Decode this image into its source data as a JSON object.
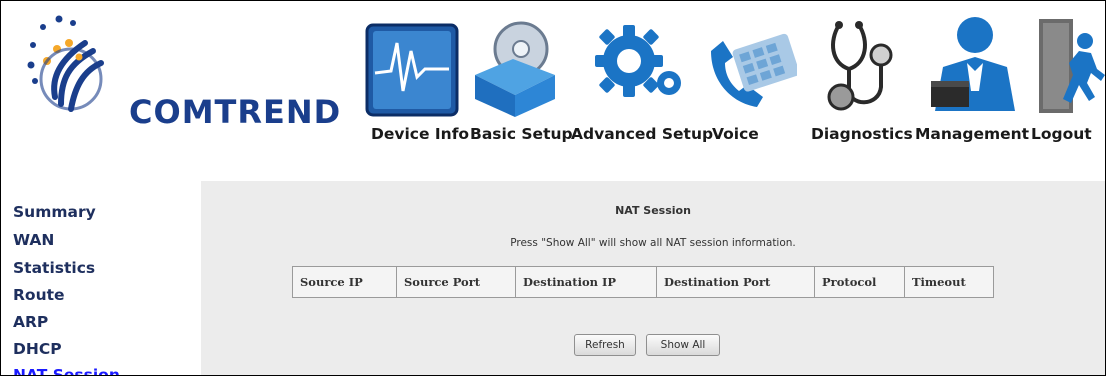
{
  "header": {
    "brand": "COMTREND",
    "nav": [
      {
        "label": "Device Info",
        "icon": "device-info-icon"
      },
      {
        "label": "Basic Setup",
        "icon": "basic-setup-icon"
      },
      {
        "label": "Advanced Setup",
        "icon": "advanced-setup-icon"
      },
      {
        "label": "Voice",
        "icon": "voice-icon"
      },
      {
        "label": "Diagnostics",
        "icon": "diagnostics-icon"
      },
      {
        "label": "Management",
        "icon": "management-icon"
      },
      {
        "label": "Logout",
        "icon": "logout-icon"
      }
    ]
  },
  "sidebar": {
    "items": [
      {
        "label": "Summary"
      },
      {
        "label": "WAN"
      },
      {
        "label": "Statistics"
      },
      {
        "label": "Route"
      },
      {
        "label": "ARP"
      },
      {
        "label": "DHCP"
      },
      {
        "label": "NAT Session",
        "active": true
      }
    ]
  },
  "main": {
    "title": "NAT Session",
    "description": "Press \"Show All\" will show all NAT session information.",
    "table": {
      "columns": [
        "Source IP",
        "Source Port",
        "Destination IP",
        "Destination Port",
        "Protocol",
        "Timeout"
      ],
      "rows": []
    },
    "buttons": {
      "refresh": "Refresh",
      "show_all": "Show All"
    }
  },
  "colors": {
    "brand_blue": "#1a3e8c",
    "main_bg": "#ececec",
    "sidebar_text": "#1e2f5e",
    "sidebar_active": "#1a1aff"
  }
}
